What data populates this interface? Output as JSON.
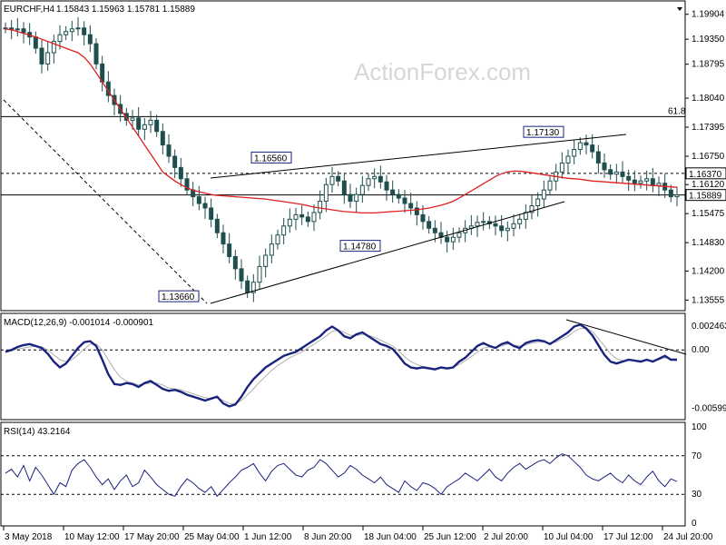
{
  "header": {
    "symbol": "EURCHF,H4",
    "ohlc": "1.15843 1.15963 1.15781 1.15889"
  },
  "watermark": "ActionForex.com",
  "colors": {
    "candle": "#1f4e4e",
    "ma": "#e02020",
    "macd": "#1a237e",
    "signal": "#b0b0b0",
    "rsi": "#1a237e",
    "trendline": "#000000",
    "level_line": "#000000"
  },
  "chart_data": [
    {
      "type": "candlestick",
      "title": "EURCHF,H4",
      "y_ticks": [
        "1.19904",
        "1.19350",
        "1.18795",
        "1.18040",
        "1.17395",
        "1.16750",
        "1.16120",
        "1.15475",
        "1.14830",
        "1.14200",
        "1.13555"
      ],
      "ylim": [
        1.134,
        1.201
      ],
      "current_price": "1.15889",
      "levels": [
        {
          "label": "61.8",
          "value": 1.1763,
          "style": "solid"
        },
        {
          "label": "1.16370",
          "value": 1.1637,
          "style": "dashed"
        },
        {
          "label": "1.15889",
          "value": 1.15889,
          "style": "solid"
        }
      ],
      "annotations": [
        {
          "text": "1.13660",
          "value": 1.1366
        },
        {
          "text": "1.16560",
          "value": 1.1656
        },
        {
          "text": "1.14780",
          "value": 1.1478
        },
        {
          "text": "1.17130",
          "value": 1.1713
        }
      ],
      "close_series": [
        1.196,
        1.1956,
        1.1958,
        1.195,
        1.194,
        1.1915,
        1.188,
        1.1905,
        1.193,
        1.1945,
        1.1952,
        1.1958,
        1.196,
        1.1945,
        1.1925,
        1.188,
        1.184,
        1.181,
        1.179,
        1.177,
        1.1755,
        1.176,
        1.1735,
        1.1745,
        1.1755,
        1.173,
        1.17,
        1.1675,
        1.165,
        1.1625,
        1.16,
        1.1585,
        1.157,
        1.156,
        1.1535,
        1.1505,
        1.148,
        1.1452,
        1.1425,
        1.1398,
        1.1372,
        1.1395,
        1.143,
        1.1455,
        1.148,
        1.15,
        1.152,
        1.1535,
        1.1545,
        1.154,
        1.153,
        1.155,
        1.1575,
        1.1612,
        1.163,
        1.162,
        1.159,
        1.1575,
        1.159,
        1.161,
        1.1625,
        1.163,
        1.1618,
        1.16,
        1.159,
        1.1582,
        1.157,
        1.156,
        1.1545,
        1.153,
        1.1515,
        1.1505,
        1.1495,
        1.1485,
        1.1495,
        1.1505,
        1.1515,
        1.152,
        1.1528,
        1.153,
        1.1525,
        1.152,
        1.151,
        1.1515,
        1.1525,
        1.1535,
        1.155,
        1.1565,
        1.158,
        1.16,
        1.162,
        1.164,
        1.166,
        1.1675,
        1.169,
        1.1705,
        1.17,
        1.1685,
        1.166,
        1.1645,
        1.1635,
        1.164,
        1.163,
        1.1622,
        1.1615,
        1.162,
        1.1625,
        1.161,
        1.1615,
        1.16,
        1.1585,
        1.15889
      ],
      "ma_series": [
        1.1958,
        1.1956,
        1.1952,
        1.1948,
        1.1944,
        1.194,
        1.1935,
        1.193,
        1.1925,
        1.192,
        1.1915,
        1.191,
        1.1905,
        1.1895,
        1.188,
        1.186,
        1.184,
        1.182,
        1.18,
        1.178,
        1.176,
        1.174,
        1.172,
        1.17,
        1.168,
        1.166,
        1.164,
        1.163,
        1.162,
        1.1612,
        1.1605,
        1.16,
        1.1596,
        1.1593,
        1.159,
        1.1588,
        1.1587,
        1.1586,
        1.1585,
        1.1584,
        1.1583,
        1.1582,
        1.1581,
        1.158,
        1.1578,
        1.1576,
        1.1574,
        1.1572,
        1.157,
        1.1568,
        1.1565,
        1.1562,
        1.156,
        1.1558,
        1.1556,
        1.1554,
        1.1552,
        1.1551,
        1.155,
        1.1549,
        1.1549,
        1.1549,
        1.155,
        1.1551,
        1.1552,
        1.1553,
        1.1554,
        1.1555,
        1.1556,
        1.1558,
        1.156,
        1.1563,
        1.1566,
        1.157,
        1.1575,
        1.1582,
        1.159,
        1.1598,
        1.1606,
        1.1614,
        1.1622,
        1.163,
        1.1636,
        1.164,
        1.1642,
        1.1642,
        1.164,
        1.1638,
        1.1636,
        1.1634,
        1.1632,
        1.163,
        1.1628,
        1.1626,
        1.1625,
        1.1624,
        1.1622,
        1.162,
        1.1619,
        1.1618,
        1.1617,
        1.1616,
        1.1615,
        1.1614,
        1.1613,
        1.1612,
        1.1611,
        1.161,
        1.1609,
        1.1608,
        1.1607,
        1.1606
      ]
    },
    {
      "type": "line",
      "title": "MACD(12,26,9) -0.001014 -0.000901",
      "y_ticks": [
        "0.002463",
        "0.00",
        "-0.005992"
      ],
      "ylim": [
        -0.0066,
        0.0031
      ],
      "series": [
        {
          "name": "MACD",
          "values": [
            -0.0002,
            0.0,
            0.0003,
            0.0005,
            0.0006,
            0.0004,
            0.0002,
            -0.0004,
            -0.0012,
            -0.0018,
            -0.0014,
            -0.0006,
            0.0002,
            0.0008,
            0.0009,
            0.0004,
            -0.001,
            -0.0025,
            -0.0035,
            -0.0036,
            -0.0034,
            -0.0035,
            -0.0038,
            -0.0034,
            -0.0032,
            -0.0036,
            -0.004,
            -0.0042,
            -0.0041,
            -0.0043,
            -0.0046,
            -0.0048,
            -0.005,
            -0.0052,
            -0.005,
            -0.0048,
            -0.0055,
            -0.0058,
            -0.0056,
            -0.0048,
            -0.0038,
            -0.003,
            -0.0024,
            -0.0018,
            -0.0014,
            -0.001,
            -0.0006,
            -0.0004,
            -0.0002,
            0.0002,
            0.0006,
            0.001,
            0.0014,
            0.002,
            0.0024,
            0.002,
            0.0014,
            0.0012,
            0.0016,
            0.0018,
            0.0014,
            0.001,
            0.0006,
            0.0004,
            0.0001,
            -0.0006,
            -0.0014,
            -0.0018,
            -0.0019,
            -0.0018,
            -0.0019,
            -0.002,
            -0.0018,
            -0.0019,
            -0.0018,
            -0.0012,
            -0.0008,
            -0.0002,
            0.0004,
            0.0007,
            0.0004,
            0.0002,
            0.0006,
            0.0008,
            0.0004,
            0.0002,
            0.0007,
            0.0009,
            0.001,
            0.0009,
            0.0006,
            0.001,
            0.0014,
            0.0018,
            0.0024,
            0.0026,
            0.0022,
            0.0015,
            0.0005,
            -0.0005,
            -0.0012,
            -0.0014,
            -0.0012,
            -0.001,
            -0.0011,
            -0.0012,
            -0.001,
            -0.0012,
            -0.0009,
            -0.0006,
            -0.001,
            -0.00101
          ]
        },
        {
          "name": "Signal",
          "values": [
            -0.0001,
            -0.0001,
            0.0001,
            0.0002,
            0.0003,
            0.0004,
            0.0003,
            0.0,
            -0.0005,
            -0.001,
            -0.0012,
            -0.001,
            -0.0005,
            0.0001,
            0.0006,
            0.0006,
            0.0,
            -0.001,
            -0.002,
            -0.0028,
            -0.0032,
            -0.0034,
            -0.0036,
            -0.0035,
            -0.0034,
            -0.0034,
            -0.0036,
            -0.0039,
            -0.004,
            -0.0041,
            -0.0043,
            -0.0045,
            -0.0047,
            -0.0049,
            -0.005,
            -0.0049,
            -0.0052,
            -0.0055,
            -0.0055,
            -0.0052,
            -0.0046,
            -0.004,
            -0.0033,
            -0.0027,
            -0.0021,
            -0.0016,
            -0.0012,
            -0.0008,
            -0.0005,
            -0.0002,
            0.0002,
            0.0006,
            0.001,
            0.0014,
            0.0019,
            0.002,
            0.0018,
            0.0015,
            0.0015,
            0.0016,
            0.0015,
            0.0013,
            0.001,
            0.0007,
            0.0004,
            -0.0001,
            -0.0007,
            -0.0012,
            -0.0015,
            -0.0017,
            -0.0018,
            -0.0019,
            -0.0019,
            -0.0019,
            -0.0018,
            -0.0015,
            -0.0011,
            -0.0007,
            -0.0002,
            0.0002,
            0.0003,
            0.0003,
            0.0004,
            0.0006,
            0.0005,
            0.0004,
            0.0005,
            0.0007,
            0.0008,
            0.0008,
            0.0007,
            0.0008,
            0.0011,
            0.0014,
            0.0019,
            0.0022,
            0.0022,
            0.0019,
            0.0012,
            0.0004,
            -0.0004,
            -0.0009,
            -0.0011,
            -0.0011,
            -0.0011,
            -0.0011,
            -0.0011,
            -0.0011,
            -0.001,
            -0.0008,
            -0.0009,
            -0.000901
          ]
        }
      ]
    },
    {
      "type": "line",
      "title": "RSI(14) 43.2164",
      "y_ticks": [
        "100",
        "70",
        "30",
        "0"
      ],
      "ylim": [
        0,
        100
      ],
      "series": [
        {
          "name": "RSI",
          "values": [
            52,
            56,
            48,
            60,
            44,
            58,
            50,
            40,
            30,
            42,
            38,
            55,
            62,
            66,
            58,
            48,
            40,
            46,
            35,
            44,
            50,
            38,
            42,
            55,
            48,
            40,
            35,
            30,
            28,
            38,
            46,
            42,
            36,
            32,
            38,
            28,
            35,
            42,
            48,
            55,
            58,
            62,
            52,
            44,
            54,
            60,
            62,
            56,
            50,
            48,
            55,
            58,
            66,
            62,
            55,
            48,
            52,
            60,
            56,
            50,
            46,
            42,
            48,
            40,
            36,
            32,
            44,
            38,
            34,
            42,
            40,
            36,
            30,
            38,
            42,
            46,
            52,
            48,
            44,
            50,
            56,
            48,
            44,
            52,
            58,
            62,
            56,
            60,
            64,
            66,
            62,
            68,
            72,
            70,
            64,
            58,
            50,
            46,
            44,
            48,
            52,
            46,
            42,
            50,
            44,
            40,
            48,
            54,
            44,
            38,
            46,
            43.2164
          ]
        }
      ],
      "levels": [
        70,
        30
      ]
    }
  ],
  "x_axis": {
    "labels": [
      "3 May 2018",
      "10 May 12:00",
      "17 May 20:00",
      "25 May 04:00",
      "1 Jun 12:00",
      "8 Jun 20:00",
      "18 Jun 04:00",
      "25 Jun 12:00",
      "2 Jul 20:00",
      "10 Jul 04:00",
      "17 Jul 12:00",
      "24 Jul 20:00"
    ]
  }
}
